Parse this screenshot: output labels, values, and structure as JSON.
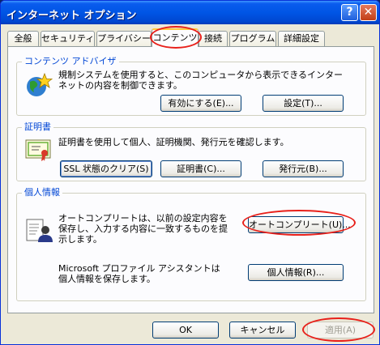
{
  "window": {
    "title": "インターネット オプション",
    "help_glyph": "?",
    "close_glyph": "✕"
  },
  "tabs": [
    {
      "label": "全般"
    },
    {
      "label": "セキュリティ"
    },
    {
      "label": "プライバシー"
    },
    {
      "label": "コンテンツ"
    },
    {
      "label": "接続"
    },
    {
      "label": "プログラム"
    },
    {
      "label": "詳細設定"
    }
  ],
  "content_advisor": {
    "title": "コンテンツ アドバイザ",
    "description": "規制システムを使用すると、このコンピュータから表示できるインターネットの内容を制御できます。",
    "enable_button": "有効にする(E)...",
    "settings_button": "設定(T)..."
  },
  "certificates": {
    "title": "証明書",
    "description": "証明書を使用して個人、証明機関、発行元を確認します。",
    "clear_ssl_button": "SSL 状態のクリア(S)",
    "certificates_button": "証明書(C)...",
    "publishers_button": "発行元(B)..."
  },
  "personal_info": {
    "title": "個人情報",
    "autocomplete_description": "オートコンプリートは、以前の設定内容を保存し、入力する内容に一致するものを提示します。",
    "autocomplete_button": "オートコンプリート(U)...",
    "profile_description": "Microsoft プロファイル アシスタントは個人情報を保存します。",
    "profile_button": "個人情報(R)..."
  },
  "footer": {
    "ok_button": "OK",
    "cancel_button": "キャンセル",
    "apply_button": "適用(A)"
  }
}
